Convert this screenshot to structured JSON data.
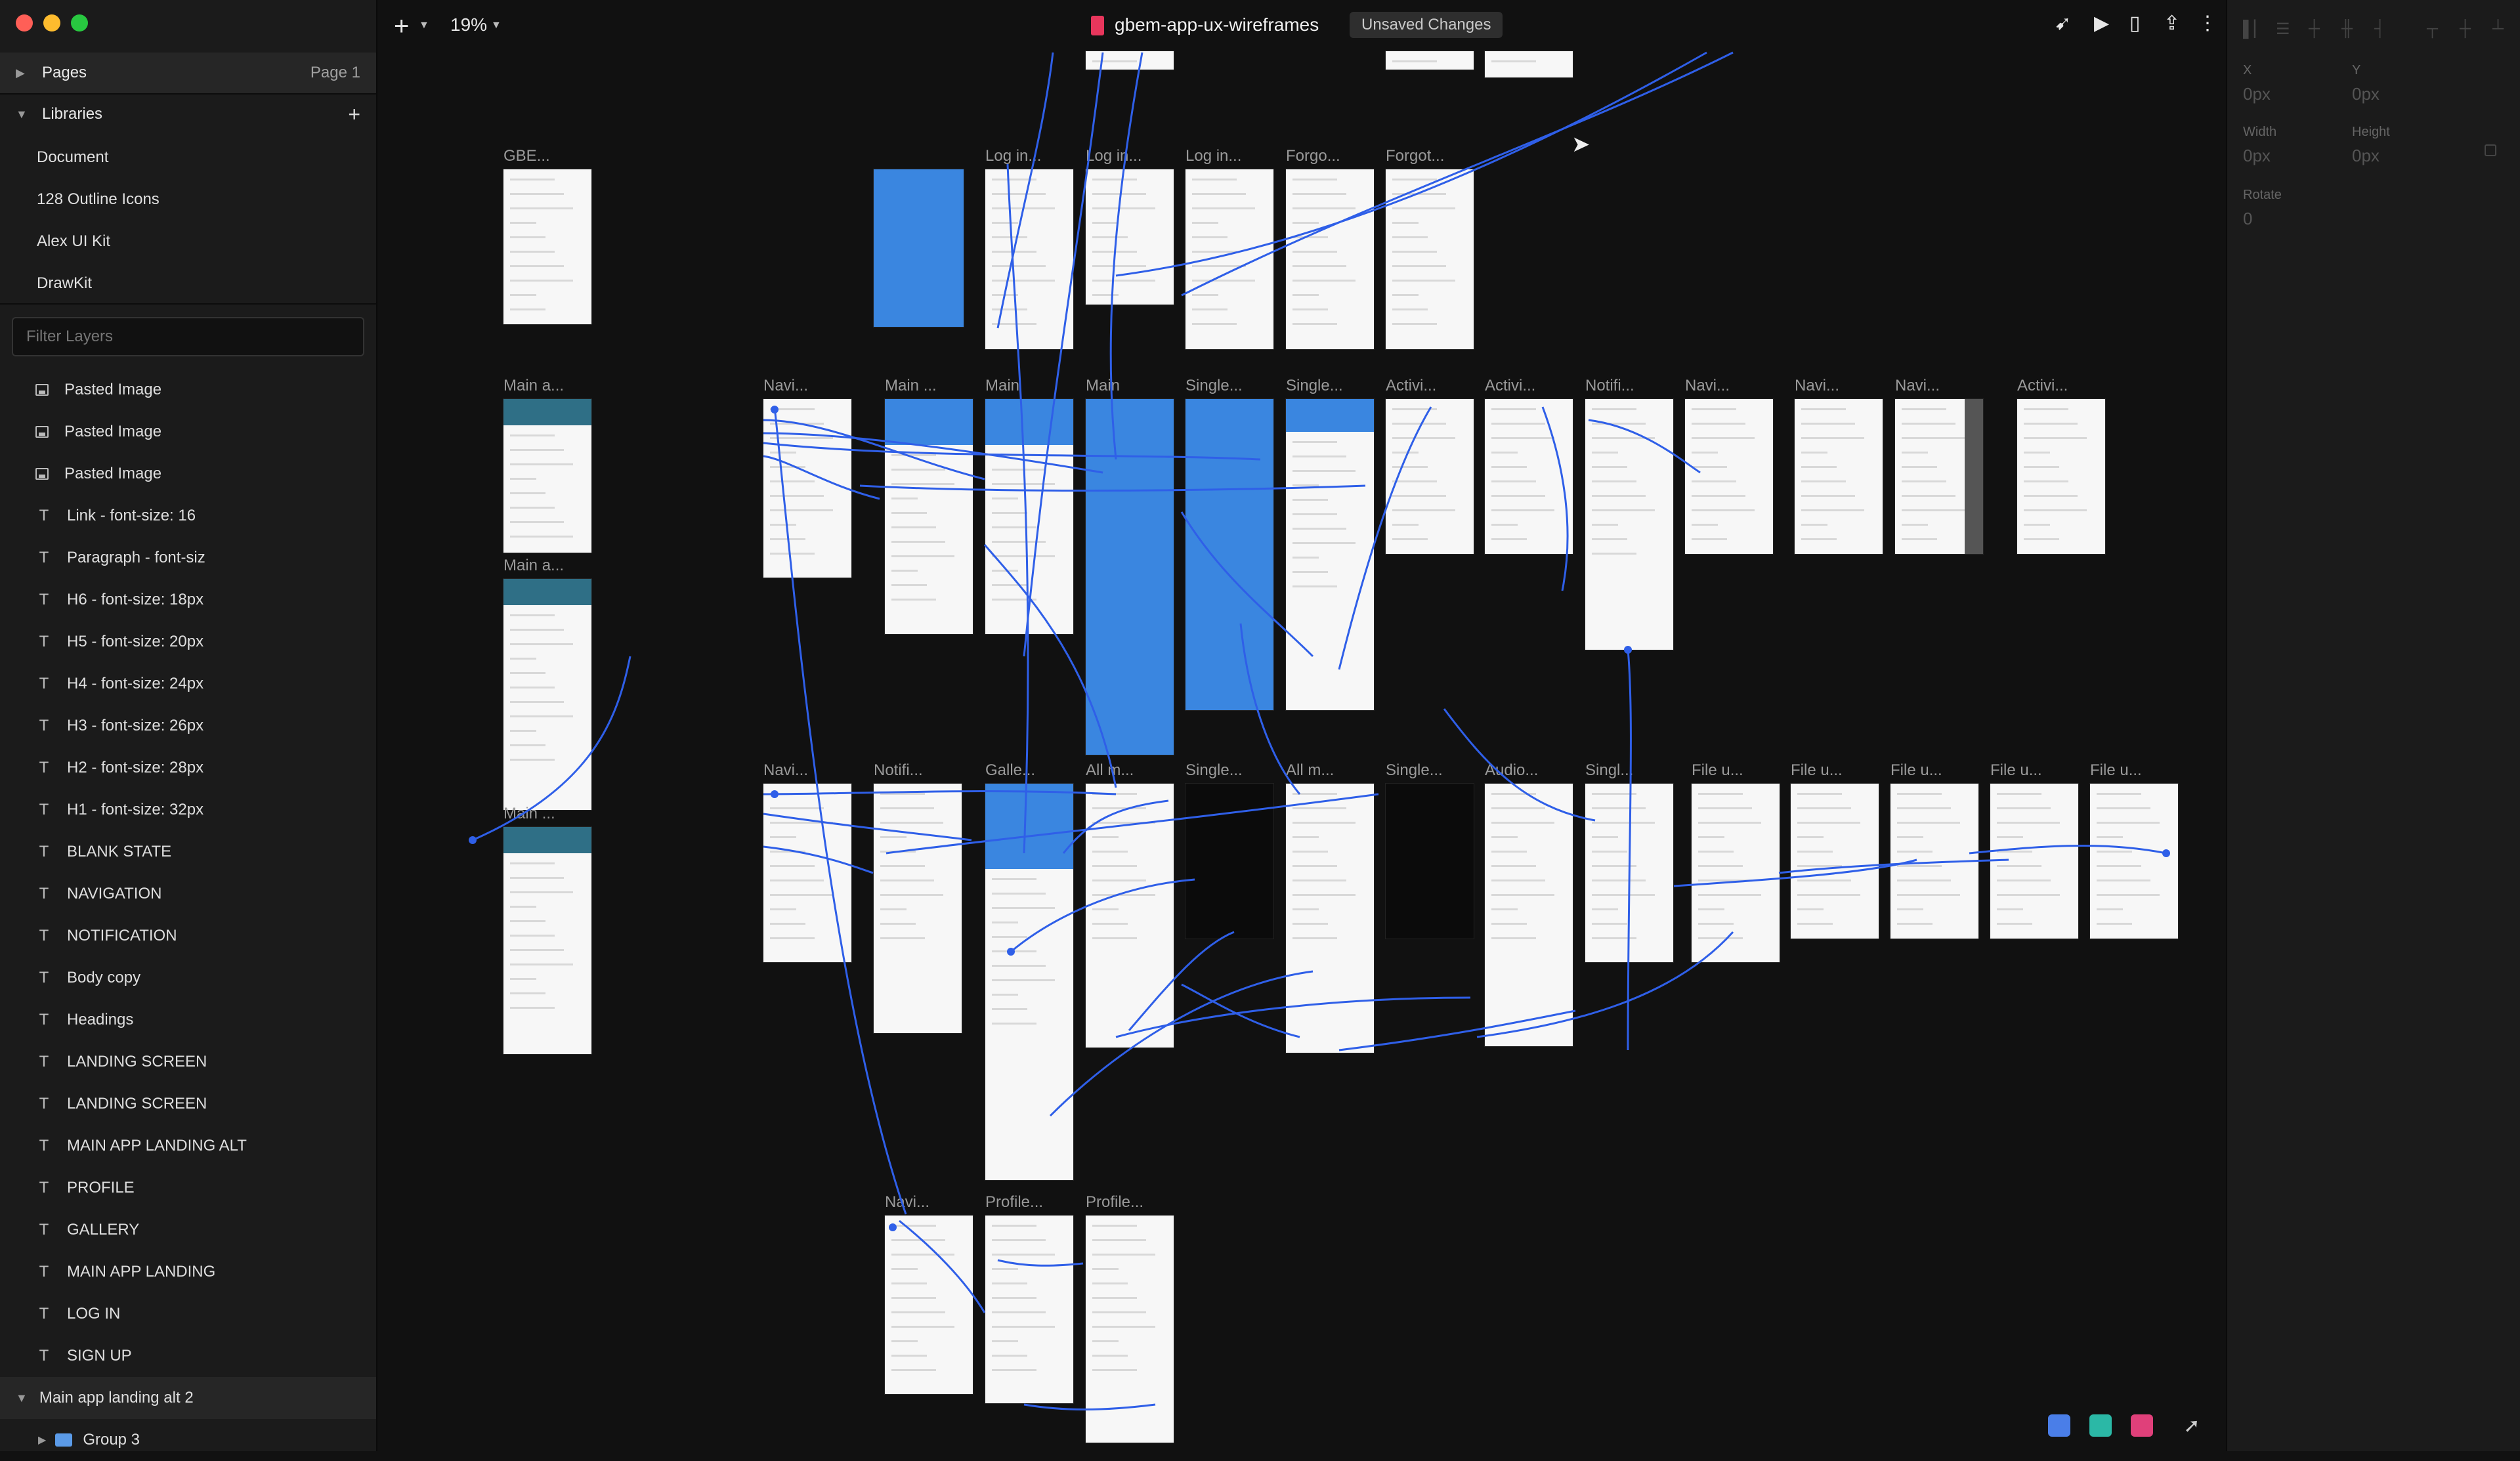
{
  "sidebar": {
    "pages_label": "Pages",
    "pages_value": "Page 1",
    "libraries_label": "Libraries",
    "libraries_add": "+",
    "libraries": [
      "Document",
      "128 Outline Icons",
      "Alex UI Kit",
      "DrawKit"
    ],
    "filter_placeholder": "Filter Layers",
    "layers": [
      {
        "icon": "image",
        "label": "Pasted Image"
      },
      {
        "icon": "image",
        "label": "Pasted Image"
      },
      {
        "icon": "image",
        "label": "Pasted Image"
      },
      {
        "icon": "text",
        "label": "Link - font-size: 16"
      },
      {
        "icon": "text",
        "label": "Paragraph - font-siz"
      },
      {
        "icon": "text",
        "label": "H6 - font-size: 18px"
      },
      {
        "icon": "text",
        "label": "H5 - font-size: 20px"
      },
      {
        "icon": "text",
        "label": "H4 - font-size: 24px"
      },
      {
        "icon": "text",
        "label": "H3 - font-size: 26px"
      },
      {
        "icon": "text",
        "label": "H2 - font-size: 28px"
      },
      {
        "icon": "text",
        "label": "H1 - font-size: 32px"
      },
      {
        "icon": "text",
        "label": "BLANK STATE"
      },
      {
        "icon": "text",
        "label": "NAVIGATION"
      },
      {
        "icon": "text",
        "label": "NOTIFICATION"
      },
      {
        "icon": "text",
        "label": "Body copy"
      },
      {
        "icon": "text",
        "label": "Headings"
      },
      {
        "icon": "text",
        "label": "LANDING SCREEN"
      },
      {
        "icon": "text",
        "label": "LANDING SCREEN"
      },
      {
        "icon": "text",
        "label": "MAIN APP LANDING ALT"
      },
      {
        "icon": "text",
        "label": "PROFILE"
      },
      {
        "icon": "text",
        "label": "GALLERY"
      },
      {
        "icon": "text",
        "label": "MAIN APP LANDING"
      },
      {
        "icon": "text",
        "label": "LOG IN"
      },
      {
        "icon": "text",
        "label": "SIGN UP"
      }
    ],
    "selected_group": "Main app landing alt 2",
    "child_group": "Group 3"
  },
  "toolbar": {
    "add_icon": "plus-icon",
    "zoom": "19%",
    "document_title": "gbem-app-ux-wireframes",
    "status": "Unsaved Changes",
    "accent": "#e8365c"
  },
  "inspector": {
    "x_label": "X",
    "x_value": "0px",
    "y_label": "Y",
    "y_value": "0px",
    "width_label": "Width",
    "width_value": "0px",
    "height_label": "Height",
    "height_value": "0px",
    "rotate_label": "Rotate",
    "rotate_value": "0"
  },
  "canvas": {
    "link_color": "#2f5fe8",
    "artboard_labels": [
      "GBE...",
      "Log in...",
      "Log in...",
      "Log in...",
      "Forgo...",
      "Forgot...",
      "Main a...",
      "Main a...",
      "Main ...",
      "Navi...",
      "Main ...",
      "Main",
      "Main",
      "Single...",
      "Single...",
      "Activi...",
      "Activi...",
      "Notifi...",
      "Navi...",
      "Navi...",
      "Navi...",
      "Activi...",
      "Navi...",
      "Notifi...",
      "Galle...",
      "All m...",
      "Single...",
      "All m...",
      "Single...",
      "Audio...",
      "Singl...",
      "File u...",
      "File u...",
      "File u...",
      "File u...",
      "File u...",
      "Navi...",
      "Profile...",
      "Profile..."
    ]
  }
}
